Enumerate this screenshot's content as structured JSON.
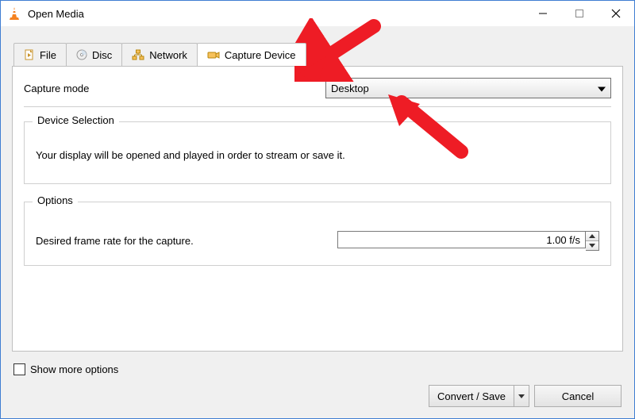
{
  "window": {
    "title": "Open Media"
  },
  "tabs": {
    "file": {
      "label": "File"
    },
    "disc": {
      "label": "Disc"
    },
    "network": {
      "label": "Network"
    },
    "capture": {
      "label": "Capture Device"
    }
  },
  "capture": {
    "mode_label": "Capture mode",
    "mode_value": "Desktop",
    "device_selection": {
      "legend": "Device Selection",
      "text": "Your display will be opened and played in order to stream or save it."
    },
    "options": {
      "legend": "Options",
      "frame_rate_label": "Desired frame rate for the capture.",
      "frame_rate_value": "1.00 f/s"
    }
  },
  "show_more_label": "Show more options",
  "footer": {
    "convert_label": "Convert / Save",
    "cancel_label": "Cancel"
  }
}
